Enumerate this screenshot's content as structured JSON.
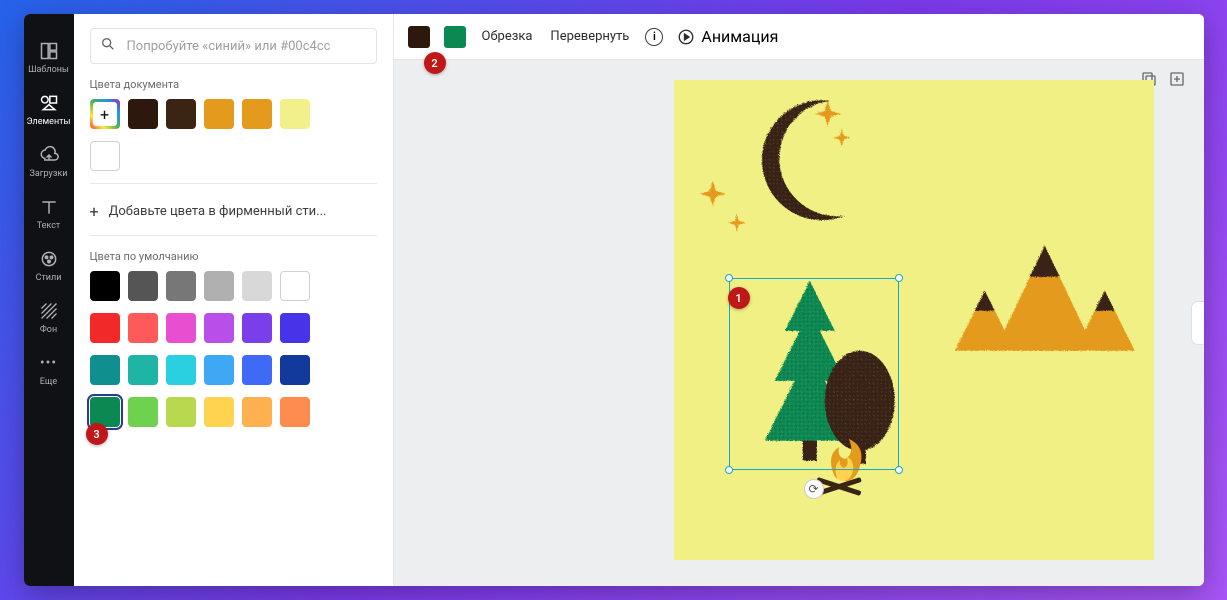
{
  "nav": {
    "templates": "Шаблоны",
    "elements": "Элементы",
    "uploads": "Загрузки",
    "text": "Текст",
    "styles": "Стили",
    "background": "Фон",
    "more": "Еще"
  },
  "panel": {
    "search_placeholder": "Попробуйте «синий» или #00c4cc",
    "doc_colors_label": "Цвета документа",
    "doc_colors": [
      "#2c180d",
      "#3a2414",
      "#e49a1c",
      "#e49a1c",
      "#f2f08a",
      "#ffffff"
    ],
    "brand_add_label": "Добавьте цвета в фирменный сти...",
    "default_colors_label": "Цвета по умолчанию",
    "default_colors": [
      [
        "#000000",
        "#555555",
        "#777777",
        "#b0b0b0",
        "#d8d8d8",
        "#ffffff"
      ],
      [
        "#f22929",
        "#ff5a5a",
        "#e84fd0",
        "#b74fe8",
        "#7a3fe8",
        "#4733e8"
      ],
      [
        "#0f8f8f",
        "#1fb5a5",
        "#2acfe0",
        "#3fa8f5",
        "#3f6af5",
        "#123a9c"
      ],
      [
        "#0a8a52",
        "#6fd24f",
        "#b8d94f",
        "#ffd24f",
        "#ffb04f",
        "#ff8c4f"
      ]
    ],
    "selected_default": "#0a8a52"
  },
  "toolbar": {
    "color1": "#2c180d",
    "color2": "#0a8a52",
    "crop": "Обрезка",
    "flip": "Перевернуть",
    "animation": "Анимация"
  },
  "badges": {
    "b1": "1",
    "b2": "2",
    "b3": "3"
  }
}
